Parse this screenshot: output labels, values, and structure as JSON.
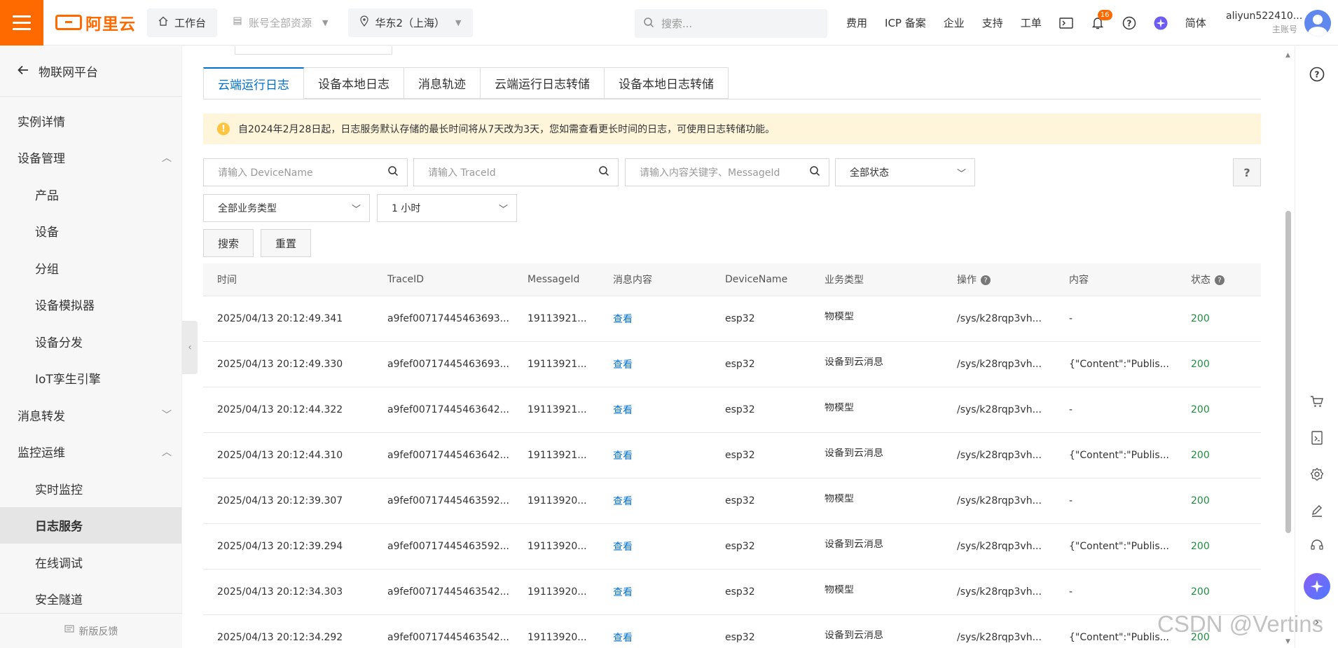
{
  "topbar": {
    "logo_text": "阿里云",
    "workbench": "工作台",
    "resources": "账号全部资源",
    "region": "华东2（上海）",
    "search_placeholder": "搜索...",
    "links": [
      "费用",
      "ICP 备案",
      "企业",
      "支持",
      "工单"
    ],
    "notification_count": "16",
    "language": "简体",
    "account_name": "aliyun522410...",
    "account_type": "主账号",
    "accent": "#ff6a00"
  },
  "sidebar": {
    "back_label": "物联网平台",
    "items": [
      {
        "label": "实例详情",
        "level": 1
      },
      {
        "label": "设备管理",
        "level": 1,
        "expanded": true
      },
      {
        "label": "产品",
        "level": 2
      },
      {
        "label": "设备",
        "level": 2
      },
      {
        "label": "分组",
        "level": 2
      },
      {
        "label": "设备模拟器",
        "level": 2
      },
      {
        "label": "设备分发",
        "level": 2
      },
      {
        "label": "IoT孪生引擎",
        "level": 2
      },
      {
        "label": "消息转发",
        "level": 1,
        "expanded": false
      },
      {
        "label": "监控运维",
        "level": 1,
        "expanded": true
      },
      {
        "label": "实时监控",
        "level": 2
      },
      {
        "label": "日志服务",
        "level": 2,
        "active": true
      },
      {
        "label": "在线调试",
        "level": 2
      },
      {
        "label": "安全隧道",
        "level": 2
      }
    ],
    "feedback": "新版反馈"
  },
  "tabs": [
    "云端运行日志",
    "设备本地日志",
    "消息轨迹",
    "云端运行日志转储",
    "设备本地日志转储"
  ],
  "notice": "自2024年2月28日起，日志服务默认存储的最长时间将从7天改为3天，您如需查看更长时间的日志，可使用日志转储功能。",
  "filters": {
    "device_placeholder": "请输入 DeviceName",
    "trace_placeholder": "请输入 TraceId",
    "content_placeholder": "请输入内容关键字、MessageId",
    "status_value": "全部状态",
    "biz_value": "全部业务类型",
    "time_value": "1 小时",
    "search_btn": "搜索",
    "reset_btn": "重置"
  },
  "table": {
    "headers": [
      "时间",
      "TraceID",
      "MessageId",
      "消息内容",
      "DeviceName",
      "业务类型",
      "操作",
      "内容",
      "状态"
    ],
    "rows": [
      [
        "2025/04/13 20:12:49.341",
        "a9fef00717445463693...",
        "19113921...",
        "查看",
        "esp32",
        "物模型",
        "/sys/k28rqp3vh...",
        "-",
        "200"
      ],
      [
        "2025/04/13 20:12:49.330",
        "a9fef00717445463693...",
        "19113921...",
        "查看",
        "esp32",
        "设备到云消息",
        "/sys/k28rqp3vh...",
        "{\"Content\":\"Publis...",
        "200"
      ],
      [
        "2025/04/13 20:12:44.322",
        "a9fef00717445463642...",
        "19113921...",
        "查看",
        "esp32",
        "物模型",
        "/sys/k28rqp3vh...",
        "-",
        "200"
      ],
      [
        "2025/04/13 20:12:44.310",
        "a9fef00717445463642...",
        "19113921...",
        "查看",
        "esp32",
        "设备到云消息",
        "/sys/k28rqp3vh...",
        "{\"Content\":\"Publis...",
        "200"
      ],
      [
        "2025/04/13 20:12:39.307",
        "a9fef00717445463592...",
        "19113920...",
        "查看",
        "esp32",
        "物模型",
        "/sys/k28rqp3vh...",
        "-",
        "200"
      ],
      [
        "2025/04/13 20:12:39.294",
        "a9fef00717445463592...",
        "19113920...",
        "查看",
        "esp32",
        "设备到云消息",
        "/sys/k28rqp3vh...",
        "{\"Content\":\"Publis...",
        "200"
      ],
      [
        "2025/04/13 20:12:34.303",
        "a9fef00717445463542...",
        "19113920...",
        "查看",
        "esp32",
        "物模型",
        "/sys/k28rqp3vh...",
        "-",
        "200"
      ],
      [
        "2025/04/13 20:12:34.292",
        "a9fef00717445463542...",
        "19113920...",
        "查看",
        "esp32",
        "设备到云消息",
        "/sys/k28rqp3vh...",
        "{\"Content\":\"Publis...",
        "200"
      ]
    ]
  },
  "watermark": "CSDN @Vertins"
}
